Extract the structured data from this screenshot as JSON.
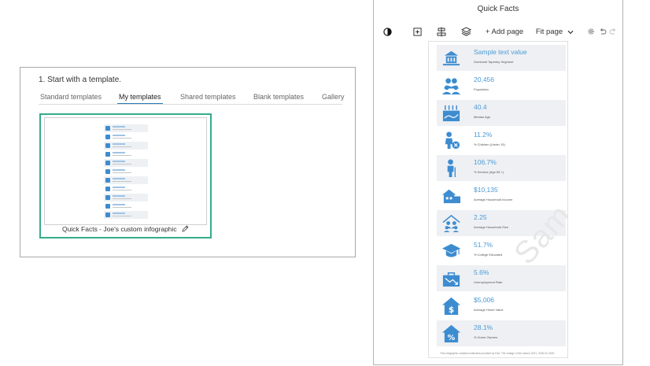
{
  "template_picker": {
    "step_title": "1. Start with a template.",
    "tabs": [
      {
        "label": "Standard templates"
      },
      {
        "label": "My templates"
      },
      {
        "label": "Shared templates"
      },
      {
        "label": "Blank templates"
      },
      {
        "label": "Gallery"
      }
    ],
    "active_tab": "My templates",
    "card": {
      "caption": "Quick Facts - Joe's custom infographic",
      "border_color": "#35ad8a"
    }
  },
  "viewer": {
    "title": "Quick Facts",
    "toolbar": {
      "add_page_label": "+ Add page",
      "zoom_label": "Fit page"
    },
    "watermark": "Sam",
    "accent_color": "#4a9ad6",
    "icon_color": "#3d8cd0",
    "rows": [
      {
        "value": "Sample text value",
        "label": "Dominant Tapestry Segment",
        "icon": "building-icon"
      },
      {
        "value": "20,456",
        "label": "Population",
        "icon": "people-icon"
      },
      {
        "value": "40.4",
        "label": "Median Age",
        "icon": "calendar-chart-icon"
      },
      {
        "value": "11.2%",
        "label": "% Children (Under 15)",
        "icon": "child-icon"
      },
      {
        "value": "106.7%",
        "label": "% Seniors (Age 65 +)",
        "icon": "senior-icon"
      },
      {
        "value": "$10,135",
        "label": "Average Household Income",
        "icon": "house-income-icon"
      },
      {
        "value": "2.25",
        "label": "Average Household Size",
        "icon": "household-size-icon"
      },
      {
        "value": "51.7%",
        "label": "% College Educated",
        "icon": "graduation-cap-icon"
      },
      {
        "value": "5.6%",
        "label": "Unemployment Rate",
        "icon": "briefcase-decline-icon"
      },
      {
        "value": "$5,006",
        "label": "Average Home Value",
        "icon": "home-dollar-icon"
      },
      {
        "value": "28.1%",
        "label": "% Home Owners",
        "icon": "home-percent-icon"
      }
    ],
    "footnote": "This infographic contains estimates provided by Esri. The vintage of the data is 2021, 2026 for 2020."
  }
}
